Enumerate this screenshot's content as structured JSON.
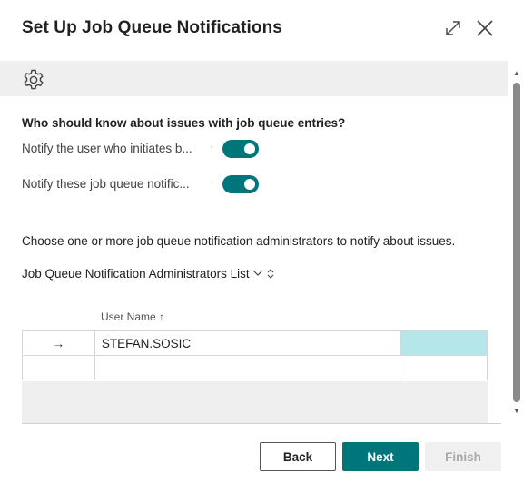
{
  "dialog": {
    "title": "Set Up Job Queue Notifications"
  },
  "icons": {
    "expand": "expand-icon",
    "close": "close-icon",
    "settings": "gear-icon"
  },
  "form": {
    "question": "Who should know about issues with job queue entries?",
    "options": [
      {
        "label": "Notify the user who initiates b...",
        "enabled": true
      },
      {
        "label": "Notify these job queue notific...",
        "enabled": true
      }
    ],
    "instruction": "Choose one or more job queue notification administrators to notify about issues.",
    "list_title": "Job Queue Notification Administrators List"
  },
  "grid": {
    "column_header": "User Name",
    "sort_indicator": "↑",
    "rows": [
      {
        "marker": "→",
        "user_name": "STEFAN.SOSIC"
      },
      {
        "marker": "",
        "user_name": ""
      }
    ]
  },
  "buttons": {
    "back": "Back",
    "next": "Next",
    "finish": "Finish"
  },
  "colors": {
    "accent": "#00767a",
    "selected_cell": "#b4e6ea"
  }
}
